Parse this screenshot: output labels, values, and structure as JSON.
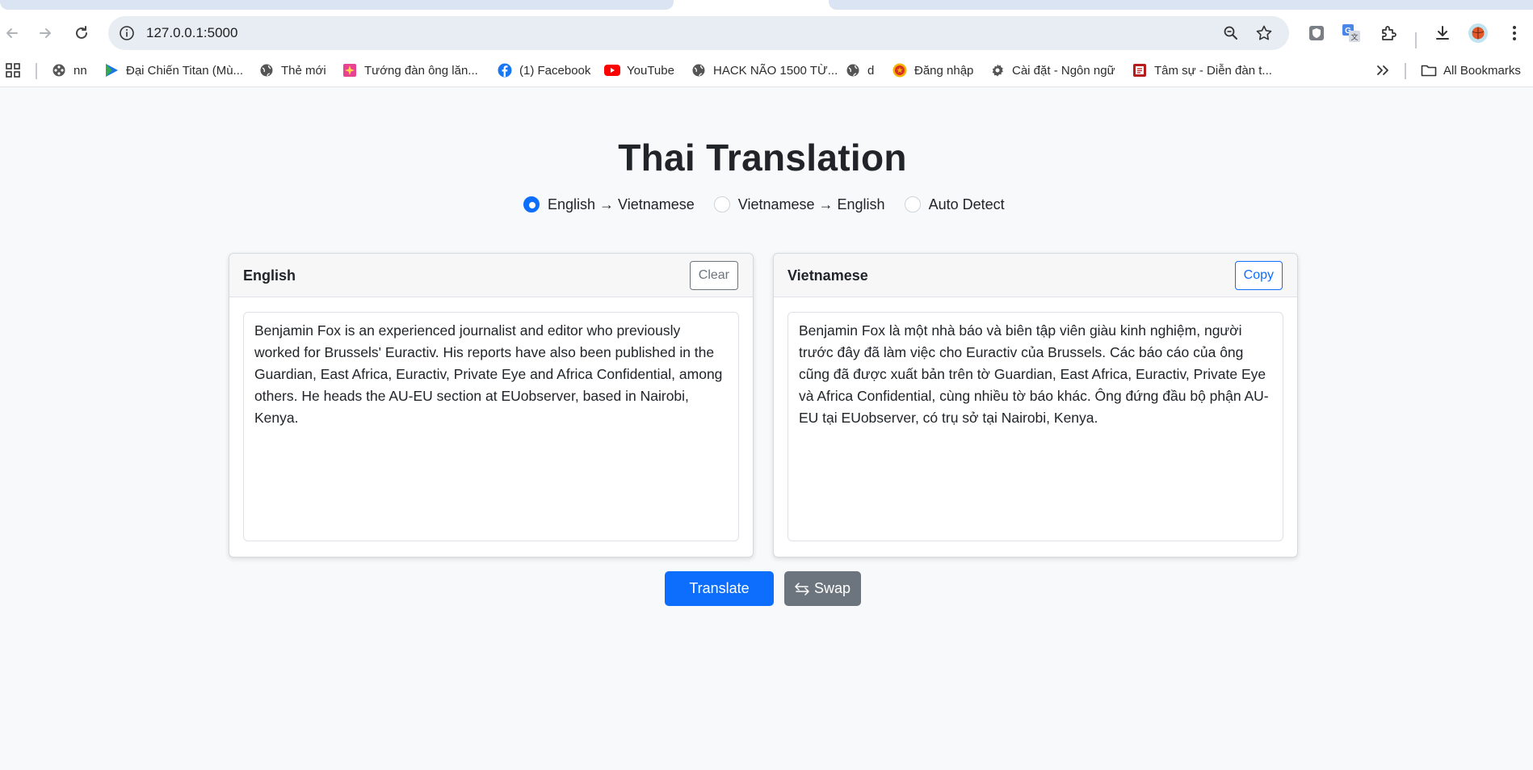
{
  "browser": {
    "url": "127.0.0.1:5000",
    "bookmarks": [
      {
        "label": "",
        "icon": "apps-grid-icon"
      },
      {
        "label": "nn",
        "icon": "film-reel-icon"
      },
      {
        "label": "Đại Chiến Titan (Mù...",
        "icon": "play-triangle-icon"
      },
      {
        "label": "Thẻ mới",
        "icon": "globe-icon"
      },
      {
        "label": "Tướng đàn ông lăn...",
        "icon": "sparkle-image-icon"
      },
      {
        "label": "(1) Facebook",
        "icon": "facebook-icon"
      },
      {
        "label": "YouTube",
        "icon": "youtube-icon"
      },
      {
        "label": "HACK NÃO 1500 TỪ...",
        "icon": "globe-icon"
      },
      {
        "label": "d",
        "icon": "globe-icon"
      },
      {
        "label": "Đăng nhập",
        "icon": "emblem-icon"
      },
      {
        "label": "Cài đặt - Ngôn ngữ",
        "icon": "gear-icon"
      },
      {
        "label": "Tâm sự - Diễn đàn t...",
        "icon": "forum-icon"
      }
    ],
    "all_bookmarks_label": "All Bookmarks"
  },
  "page": {
    "title": "Thai Translation",
    "directions": [
      {
        "label": "English → Vietnamese",
        "selected": true
      },
      {
        "label": "Vietnamese → English",
        "selected": false
      },
      {
        "label": "Auto Detect",
        "selected": false
      }
    ],
    "source": {
      "header": "English",
      "clear_label": "Clear",
      "text": "Benjamin Fox is an experienced journalist and editor who previously worked for Brussels' Euractiv. His reports have also been published in the Guardian, East Africa, Euractiv, Private Eye and Africa Confidential, among others. He heads the AU-EU section at EUobserver, based in Nairobi, Kenya."
    },
    "target": {
      "header": "Vietnamese",
      "copy_label": "Copy",
      "text": "Benjamin Fox là một nhà báo và biên tập viên giàu kinh nghiệm, người trước đây đã làm việc cho Euractiv của Brussels. Các báo cáo của ông cũng đã được xuất bản trên tờ Guardian, East Africa, Euractiv, Private Eye và Africa Confidential, cùng nhiều tờ báo khác. Ông đứng đầu bộ phận AU-EU tại EUobserver, có trụ sở tại Nairobi, Kenya."
    },
    "translate_label": "Translate",
    "swap_label": "Swap"
  },
  "colors": {
    "primary": "#0d6efd",
    "secondary": "#6c757d",
    "background": "#f8f9fa"
  }
}
